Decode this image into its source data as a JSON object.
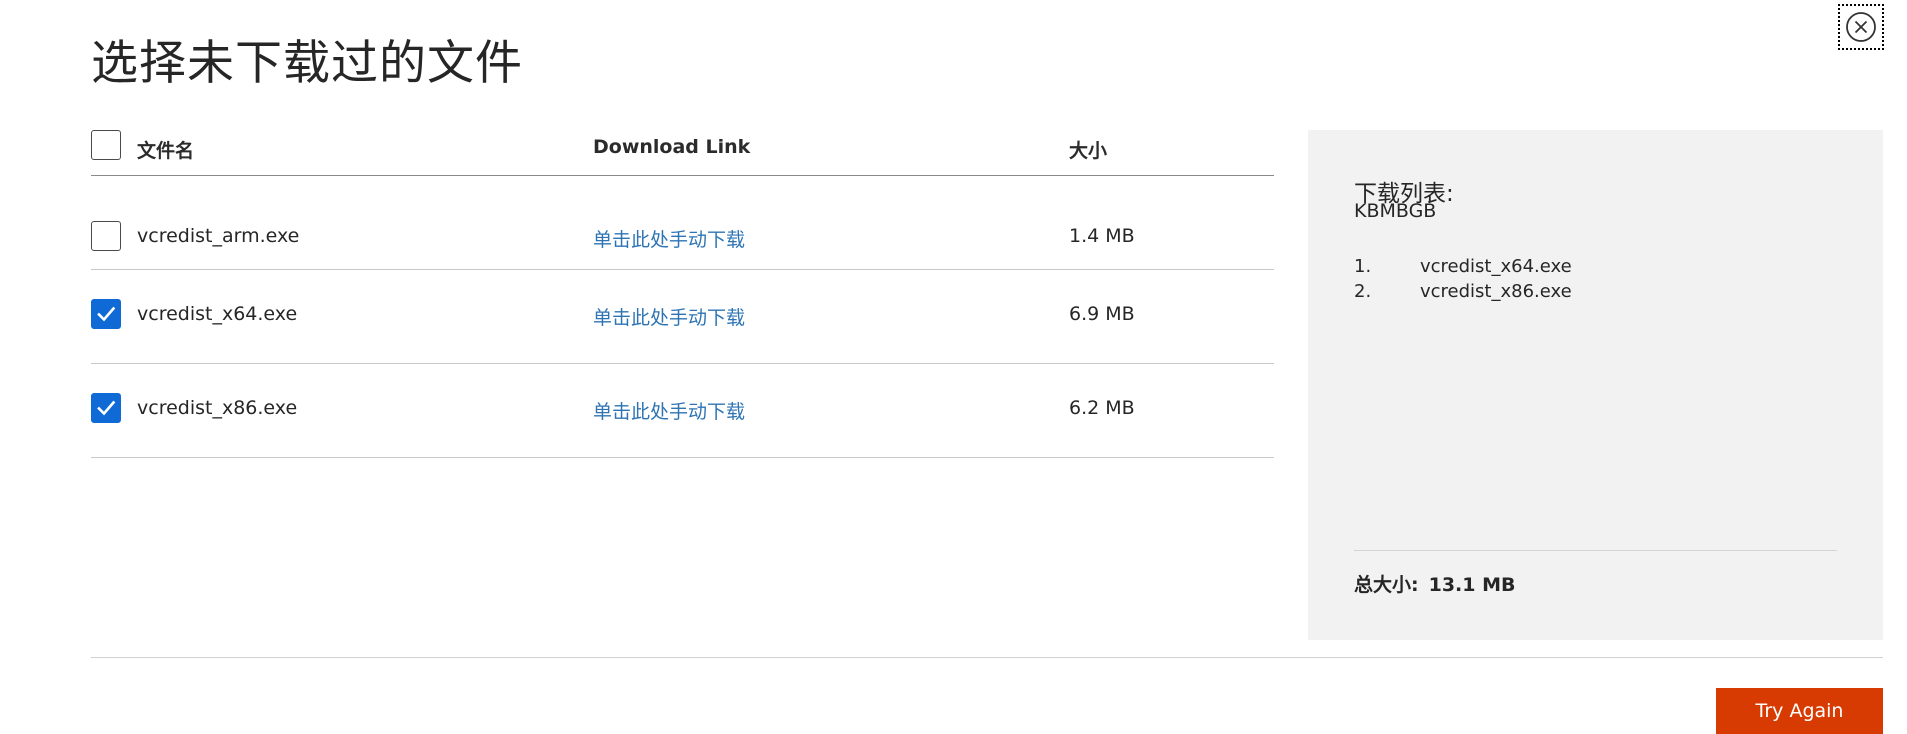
{
  "dialog": {
    "title": "选择未下载过的文件",
    "close_icon": "close-circle-icon"
  },
  "table": {
    "headers": {
      "name": "文件名",
      "link": "Download Link",
      "size": "大小"
    },
    "select_all_checked": false,
    "rows": [
      {
        "name": "vcredist_arm.exe",
        "link": "单击此处手动下载",
        "size": "1.4 MB",
        "checked": false
      },
      {
        "name": "vcredist_x64.exe",
        "link": "单击此处手动下载",
        "size": "6.9 MB",
        "checked": true
      },
      {
        "name": "vcredist_x86.exe",
        "link": "单击此处手动下载",
        "size": "6.2 MB",
        "checked": true
      }
    ]
  },
  "panel": {
    "title": "下载列表:",
    "code": "KBMBGB",
    "items": [
      {
        "num": "1.",
        "name": "vcredist_x64.exe"
      },
      {
        "num": "2.",
        "name": "vcredist_x86.exe"
      }
    ],
    "total_label": "总大小:",
    "total_value": "13.1 MB"
  },
  "actions": {
    "try_again": "Try Again"
  },
  "colors": {
    "accent_checkbox": "#0f6ad6",
    "link": "#2e74b5",
    "button": "#d83b01",
    "panel_bg": "#f2f2f2"
  }
}
